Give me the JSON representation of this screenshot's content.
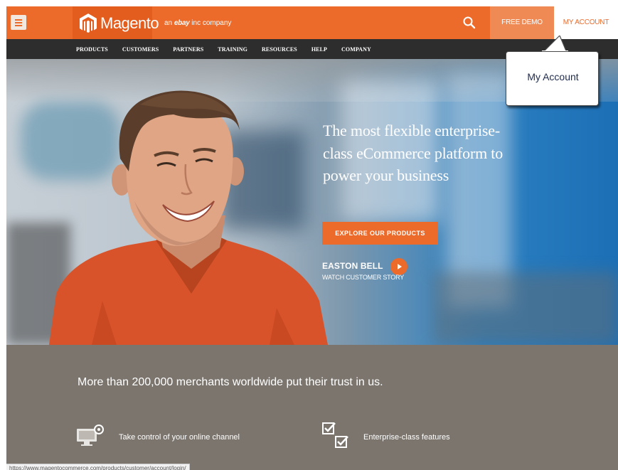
{
  "header": {
    "menu_icon": "hamburger-icon",
    "logo_text": "Magento",
    "tagline_prefix": "an",
    "tagline_ebay": "ebay",
    "tagline_suffix": "inc company",
    "search_icon": "search-icon",
    "free_demo_label": "FREE DEMO",
    "my_account_label": "MY ACCOUNT",
    "accent_color": "#ec6a2a"
  },
  "nav": {
    "items": [
      {
        "label": "PRODUCTS"
      },
      {
        "label": "CUSTOMERS"
      },
      {
        "label": "PARTNERS"
      },
      {
        "label": "TRAINING"
      },
      {
        "label": "RESOURCES"
      },
      {
        "label": "HELP"
      },
      {
        "label": "COMPANY"
      }
    ]
  },
  "callout": {
    "text": "My Account"
  },
  "hero": {
    "headline": "The most flexible enterprise-class eCommerce platform to power your business",
    "cta_label": "EXPLORE OUR PRODUCTS",
    "story_name": "EASTON BELL",
    "story_link": "WATCH CUSTOMER STORY",
    "play_icon": "play-icon"
  },
  "lower": {
    "trust_text": "More than 200,000 merchants worldwide put their trust in us.",
    "features": [
      {
        "icon": "monitor-gear-icon",
        "label": "Take control of your online channel"
      },
      {
        "icon": "checkbox-icon",
        "label": "Enterprise-class features"
      }
    ]
  },
  "status_bar": {
    "url": "https://www.magentocommerce.com/products/customer/account/login/"
  }
}
